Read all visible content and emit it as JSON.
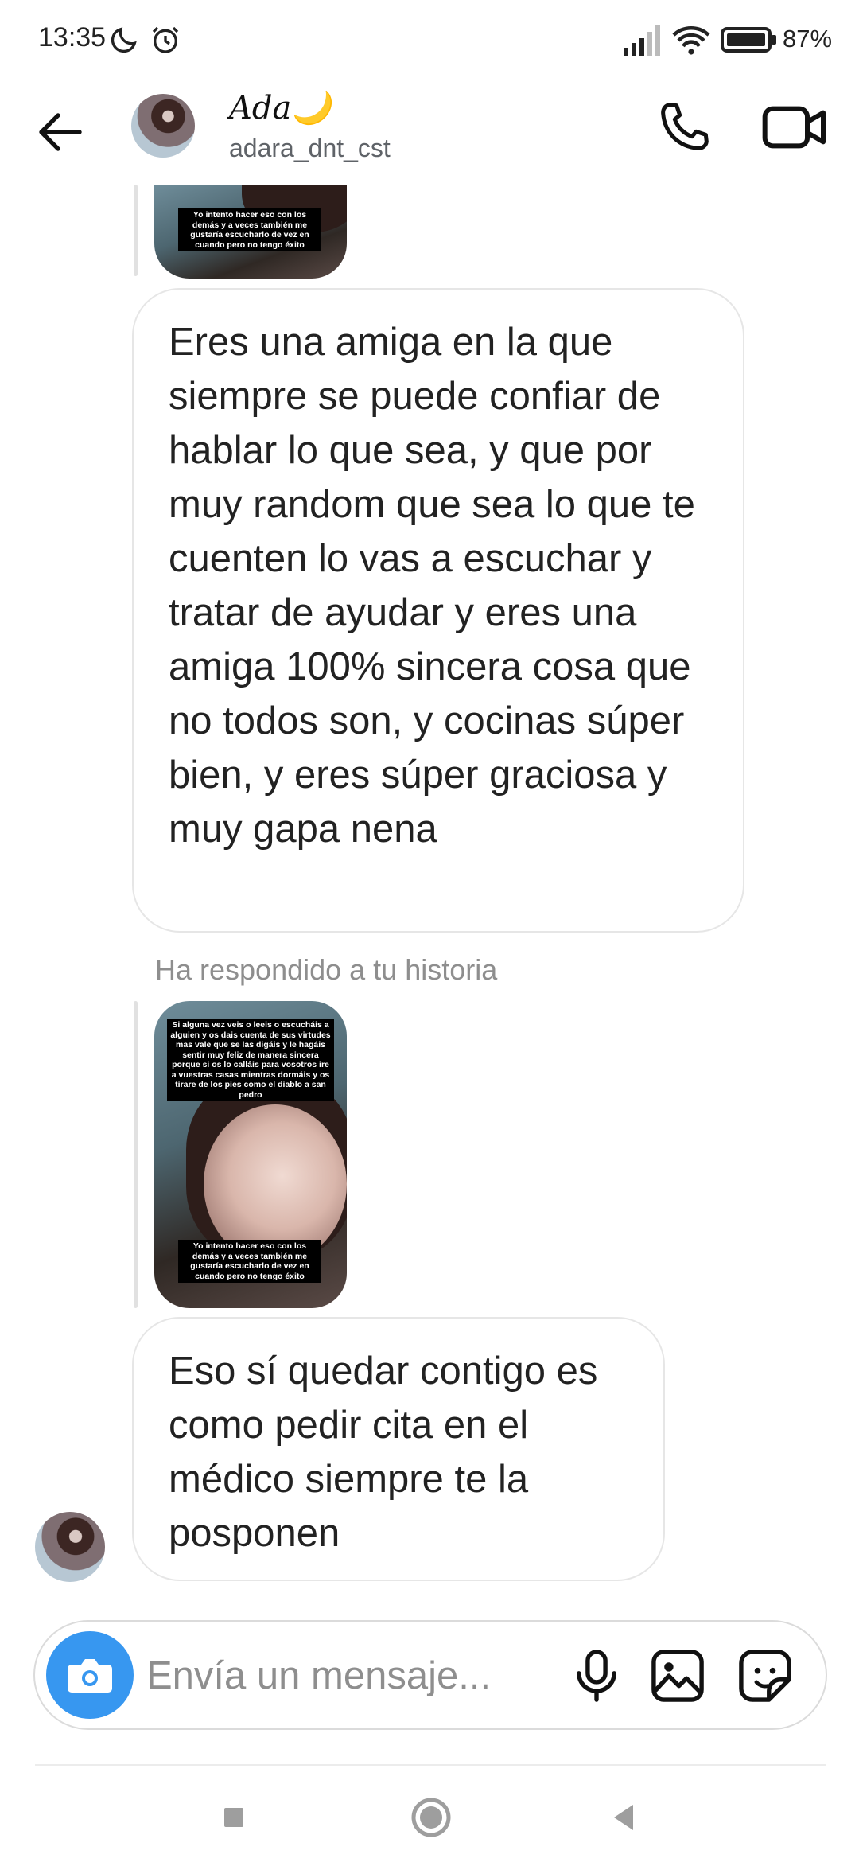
{
  "status_bar": {
    "time": "13:35",
    "battery": "87%",
    "icons": [
      "moon-icon",
      "alarm-icon",
      "signal-icon",
      "wifi-icon",
      "battery-icon"
    ]
  },
  "header": {
    "name": "Ada🌙",
    "username": "adara_dnt_cst",
    "icons": [
      "back-arrow-icon",
      "phone-icon",
      "video-icon"
    ]
  },
  "story_replies": [
    {
      "captions": [
        "Yo intento hacer eso con los demás y a veces también me gustaría escucharlo de vez en cuando pero no tengo éxito"
      ]
    },
    {
      "label": "Ha respondido a tu historia",
      "captions": [
        "Si alguna vez veis o leeis o escucháis a alguien y os dais cuenta de sus virtudes mas vale que se las digáis y le hagáis sentir muy feliz de manera sincera porque si os lo calláis para vosotros ire a vuestras casas mientras dormáis y os tirare de los pies como el diablo a san pedro",
        "Yo intento hacer eso con los demás y a veces también me gustaría escucharlo de vez en cuando pero no tengo éxito"
      ]
    }
  ],
  "messages": [
    {
      "text": "Eres una amiga en la que siempre se puede confiar de hablar lo que sea, y que por muy random que sea lo que te cuenten lo vas a escuchar y tratar de ayudar y eres una amiga 100% sincera cosa que no todos son, y cocinas súper bien, y eres súper graciosa y muy gapa nena"
    },
    {
      "text": "Eso sí quedar contigo es como pedir cita en el médico siempre te la posponen"
    }
  ],
  "composer": {
    "placeholder": "Envía un mensaje...",
    "icons": [
      "camera-icon",
      "microphone-icon",
      "gallery-icon",
      "sticker-icon"
    ]
  },
  "nav_bar": {
    "icons": [
      "recents-icon",
      "home-icon",
      "back-icon"
    ]
  },
  "colors": {
    "accent_blue": "#3797f0",
    "bubble_border": "#e6e6e6",
    "secondary_text": "#8e8e8e"
  }
}
